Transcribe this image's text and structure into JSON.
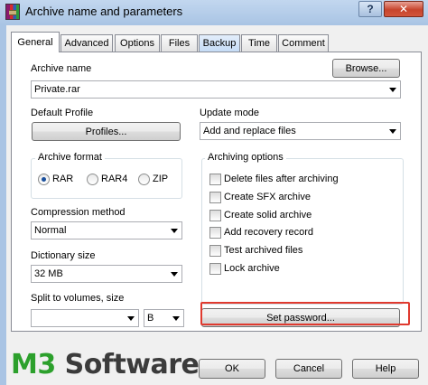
{
  "window": {
    "title": "Archive name and parameters",
    "help_label": "?",
    "close_label": "✕"
  },
  "tabs": [
    {
      "label": "General"
    },
    {
      "label": "Advanced"
    },
    {
      "label": "Options"
    },
    {
      "label": "Files"
    },
    {
      "label": "Backup"
    },
    {
      "label": "Time"
    },
    {
      "label": "Comment"
    }
  ],
  "archive_name": {
    "label": "Archive name",
    "value": "Private.rar",
    "browse_label": "Browse..."
  },
  "default_profile": {
    "label": "Default Profile",
    "profiles_label": "Profiles..."
  },
  "update_mode": {
    "label": "Update mode",
    "value": "Add and replace files"
  },
  "archive_format": {
    "label": "Archive format",
    "options": [
      {
        "label": "RAR",
        "selected": true
      },
      {
        "label": "RAR4",
        "selected": false
      },
      {
        "label": "ZIP",
        "selected": false
      }
    ]
  },
  "compression": {
    "label": "Compression method",
    "value": "Normal"
  },
  "dictionary": {
    "label": "Dictionary size",
    "value": "32 MB"
  },
  "split": {
    "label": "Split to volumes, size",
    "value": "",
    "unit": "B"
  },
  "archiving_options": {
    "label": "Archiving options",
    "items": [
      {
        "label": "Delete files after archiving",
        "checked": false
      },
      {
        "label": "Create SFX archive",
        "checked": false
      },
      {
        "label": "Create solid archive",
        "checked": false
      },
      {
        "label": "Add recovery record",
        "checked": false
      },
      {
        "label": "Test archived files",
        "checked": false
      },
      {
        "label": "Lock archive",
        "checked": false
      }
    ]
  },
  "set_password_label": "Set password...",
  "footer": {
    "ok_label": "OK",
    "cancel_label": "Cancel",
    "help_label": "Help"
  },
  "watermark": {
    "part1": "M3 ",
    "part2": "Software"
  },
  "colors": {
    "highlight": "#e03a2f",
    "logo_green": "#2ca02c"
  }
}
